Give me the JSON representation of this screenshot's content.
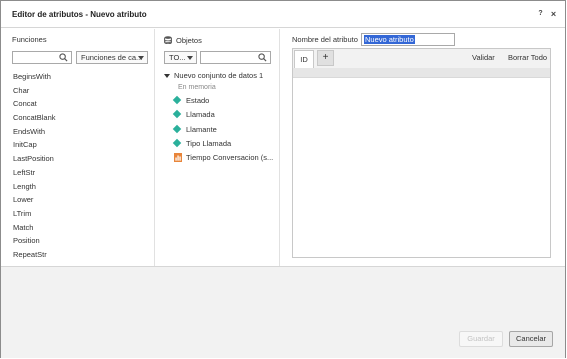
{
  "window": {
    "title": "Editor de atributos - Nuevo atributo",
    "help_label": "?",
    "close_label": "×"
  },
  "functions_panel": {
    "title": "Funciones",
    "search": {
      "value": "",
      "placeholder": ""
    },
    "category_dropdown": {
      "selected": "Funciones de ca..."
    },
    "items": [
      "BeginsWith",
      "Char",
      "Concat",
      "ConcatBlank",
      "EndsWith",
      "InitCap",
      "LastPosition",
      "LeftStr",
      "Length",
      "Lower",
      "LTrim",
      "Match",
      "Position",
      "RepeatStr"
    ]
  },
  "objects_panel": {
    "title": "Objetos",
    "type_dropdown": {
      "selected": "TO..."
    },
    "search": {
      "value": "",
      "placeholder": ""
    },
    "tree": {
      "root_label": "Nuevo conjunto de datos 1",
      "sub_label": "En memoria",
      "items": [
        {
          "label": "Estado",
          "icon": "attribute-diamond-icon"
        },
        {
          "label": "Llamada",
          "icon": "attribute-diamond-icon"
        },
        {
          "label": "Llamante",
          "icon": "attribute-diamond-icon"
        },
        {
          "label": "Tipo Llamada",
          "icon": "attribute-diamond-icon"
        },
        {
          "label": "Tiempo Conversacion (s...",
          "icon": "metric-icon"
        }
      ]
    }
  },
  "editor_panel": {
    "name_label": "Nombre del atributo",
    "name_value": "Nuevo atributo",
    "tabs": [
      {
        "label": "ID"
      }
    ],
    "add_tab_label": "+",
    "validate_label": "Validar",
    "clear_all_label": "Borrar Todo",
    "expression": ""
  },
  "footer": {
    "save_label": "Guardar",
    "cancel_label": "Cancelar"
  },
  "colors": {
    "attribute_icon": "#2ab09b",
    "metric_icon": "#e8853a",
    "selection": "#3367d6"
  }
}
